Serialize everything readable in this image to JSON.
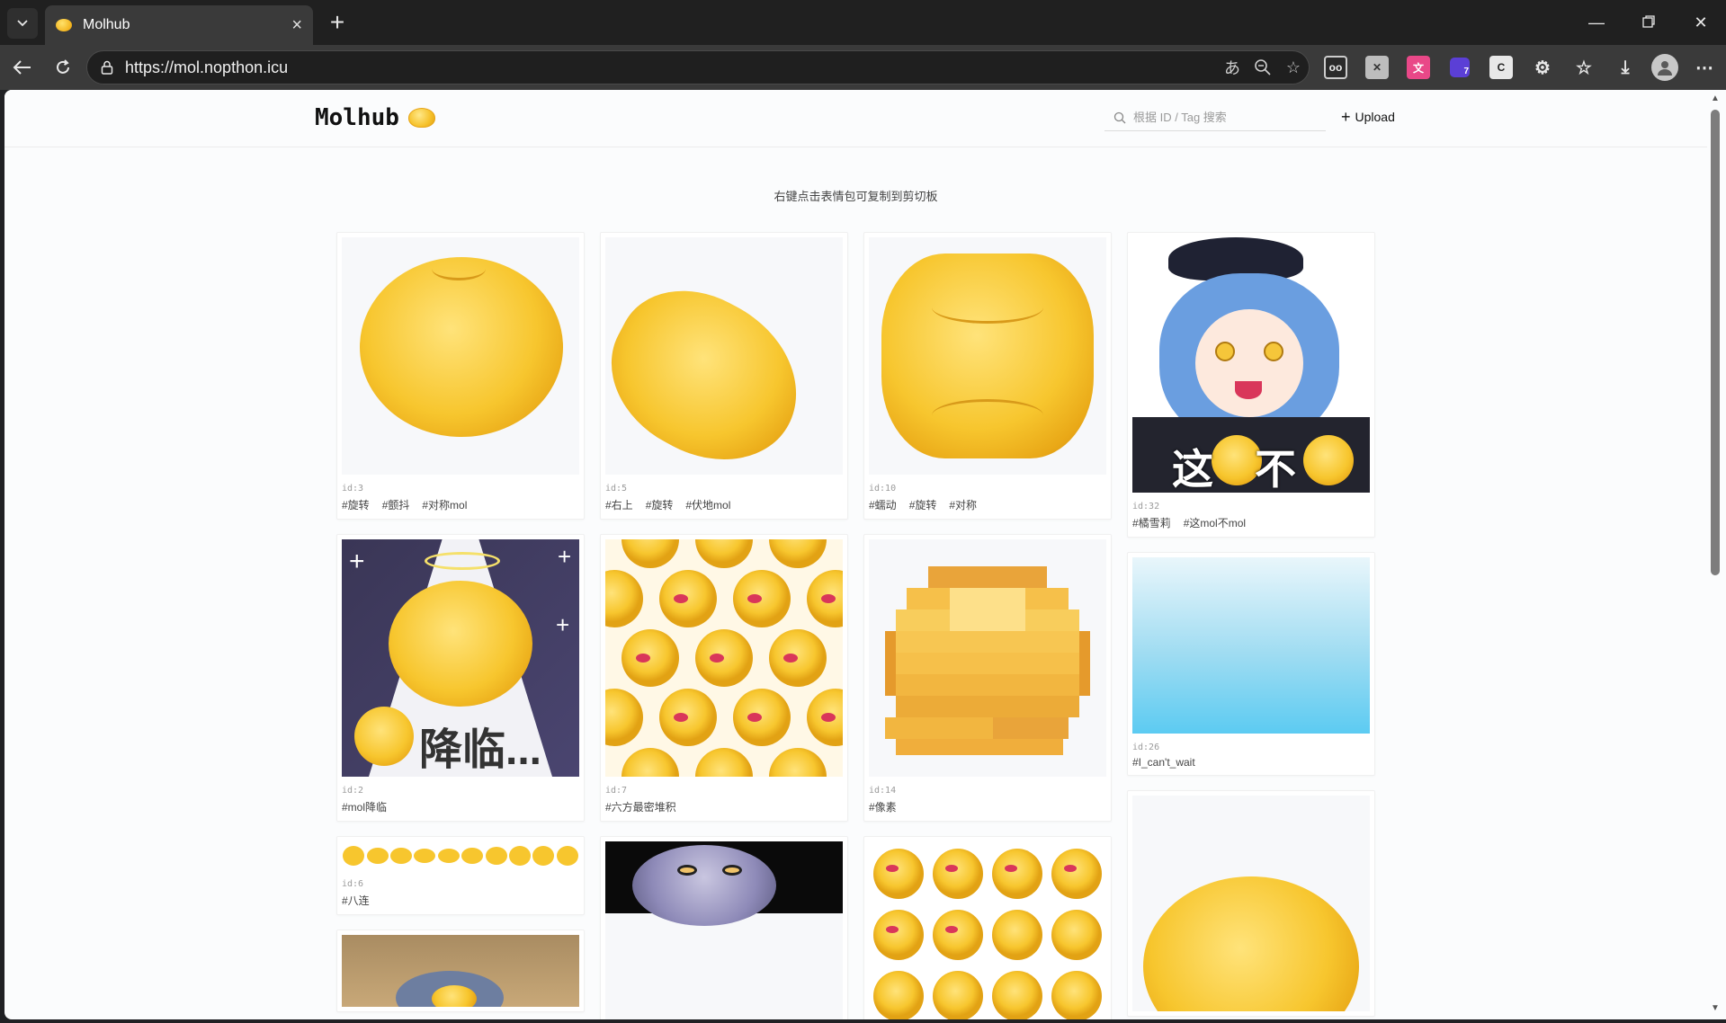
{
  "browser": {
    "tab_title": "Molhub",
    "url": "https://mol.nopthon.icu"
  },
  "site": {
    "logo": "Molhub",
    "search_placeholder": "根据 ID / Tag 搜索",
    "upload_label": "Upload",
    "hint": "右键点击表情包可复制到剪切板"
  },
  "columns": [
    {
      "cards": [
        {
          "id": "id:3",
          "tags": [
            "#旋转",
            "#颤抖",
            "#对称mol"
          ]
        },
        {
          "id": "id:2",
          "tags": [
            "#mol降临"
          ],
          "caption": "降临..."
        },
        {
          "id": "id:6",
          "tags": [
            "#八连"
          ]
        }
      ]
    },
    {
      "cards": [
        {
          "id": "id:5",
          "tags": [
            "#右上",
            "#旋转",
            "#伏地mol"
          ]
        },
        {
          "id": "id:7",
          "tags": [
            "#六方最密堆积"
          ]
        }
      ]
    },
    {
      "cards": [
        {
          "id": "id:10",
          "tags": [
            "#蠕动",
            "#旋转",
            "#对称"
          ]
        },
        {
          "id": "id:14",
          "tags": [
            "#像素"
          ]
        }
      ]
    },
    {
      "cards": [
        {
          "id": "id:32",
          "tags": [
            "#橘雪莉",
            "#这mol不mol"
          ],
          "caption": "这不"
        },
        {
          "id": "id:26",
          "tags": [
            "#I_can't_wait"
          ]
        }
      ]
    }
  ],
  "colors": {
    "mol_yellow": "#f7c62e",
    "page_bg": "#fbfcfd",
    "chrome_dark": "#202020"
  }
}
